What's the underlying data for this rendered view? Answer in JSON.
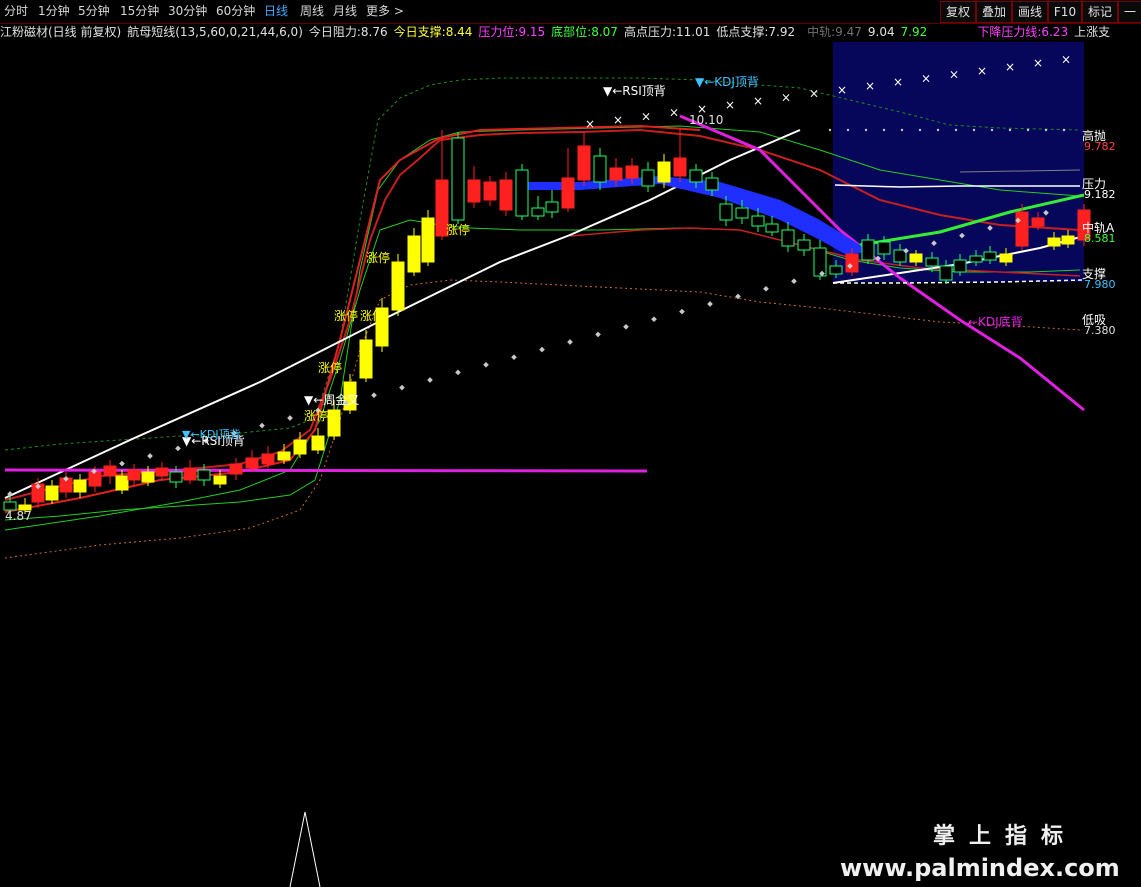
{
  "toolbar": {
    "periods": [
      "分时",
      "1分钟",
      "5分钟",
      "15分钟",
      "30分钟",
      "60分钟",
      "日线",
      "周线",
      "月线",
      "更多 >"
    ],
    "active_period": "日线",
    "right_buttons": [
      "复权",
      "叠加",
      "画线",
      "F10",
      "标记",
      "一自"
    ]
  },
  "info": {
    "stock": "江粉磁材(日线 前复权)",
    "indicator": "航母短线(13,5,60,0,21,44,6,0)",
    "today_resist_label": "今日阻力:",
    "today_resist": "8.76",
    "today_support_label": "今日支撑:",
    "today_support": "8.44",
    "pressure_label": "压力位:",
    "pressure": "9.15",
    "bottom_label": "底部位:",
    "bottom": "8.07",
    "high_pressure_label": "高点压力:",
    "high_pressure": "11.01",
    "low_support_label": "低点支撑:",
    "low_support": "7.92",
    "mid_rail_label": "中轨:",
    "mid_rail": "9.47",
    "val_a": "9.04",
    "val_b": "7.92",
    "down_line_label": "下降压力线:",
    "down_line": "6.23",
    "up_support_label": "上涨支"
  },
  "chart_text": {
    "price_high": "10.10",
    "price_low": "4.87",
    "rsi_top_1": "▼←RSI顶背",
    "rsi_top_2": "▼←RSI顶背",
    "kdj_top_1": "▼←KDJ顶背",
    "kdj_top_2": "▼←KDJ顶背",
    "kdj_bottom": "←KDJ底背",
    "week_golden": "▼←周金叉",
    "limit_up": "涨停"
  },
  "right_labels": {
    "high_throw": "高抛",
    "high_throw_val": "9.782",
    "pressure": "压力",
    "pressure_val": "9.182",
    "mid_rail": "中轨A",
    "mid_rail_val": "8.581",
    "support": "支撑",
    "support_val": "7.980",
    "low_buy": "低吸",
    "low_buy_val": "7.380"
  },
  "watermark": {
    "cn": "掌上指标",
    "url": "www.palmindex.com"
  },
  "colors": {
    "up": "#ff2020",
    "down": "#1fff6a",
    "yellow": "#ffff00",
    "blue": "#1f2fff",
    "magenta": "#e020e0",
    "white": "#ffffff",
    "bgblue": "#06065a"
  }
}
